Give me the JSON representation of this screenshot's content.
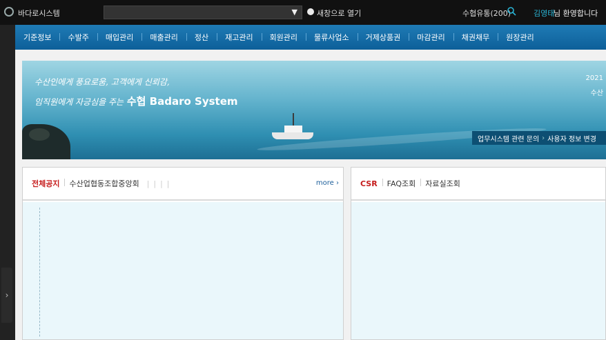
{
  "topbar": {
    "app_title": "바다로시스템",
    "open_new_window": "새창으로 열기",
    "distribution": "수협유통(200)",
    "user_name": "김영태",
    "welcome": "님 환영합니다"
  },
  "nav": {
    "items": [
      "기준정보",
      "수발주",
      "매입관리",
      "매출관리",
      "정산",
      "재고관리",
      "회원관리",
      "물류사업소",
      "거제상품권",
      "마감관리",
      "채권채무",
      "원장관리"
    ]
  },
  "banner": {
    "slogan_line1": "수산인에게 풍요로움, 고객에게 신뢰감,",
    "slogan_line2_pre": "임직원에게 자긍심을 주는",
    "slogan_line2_brand": "수협 Badaro System",
    "year": "2021",
    "corp": "수산",
    "link_inquiry": "업무시스템 관련 문의",
    "link_profile": "사용자 정보 변경"
  },
  "left_panel": {
    "tab_notice": "전체공지",
    "tab_fed": "수산업협동조합중앙회",
    "more": "more"
  },
  "right_panel": {
    "tab_csr": "CSR",
    "tab_faq": "FAQ조회",
    "tab_archive": "자료실조회"
  },
  "colors": {
    "nav_bg": "#1a74ae",
    "user_accent": "#2ab5d6",
    "notice_red": "#c51b1b"
  }
}
